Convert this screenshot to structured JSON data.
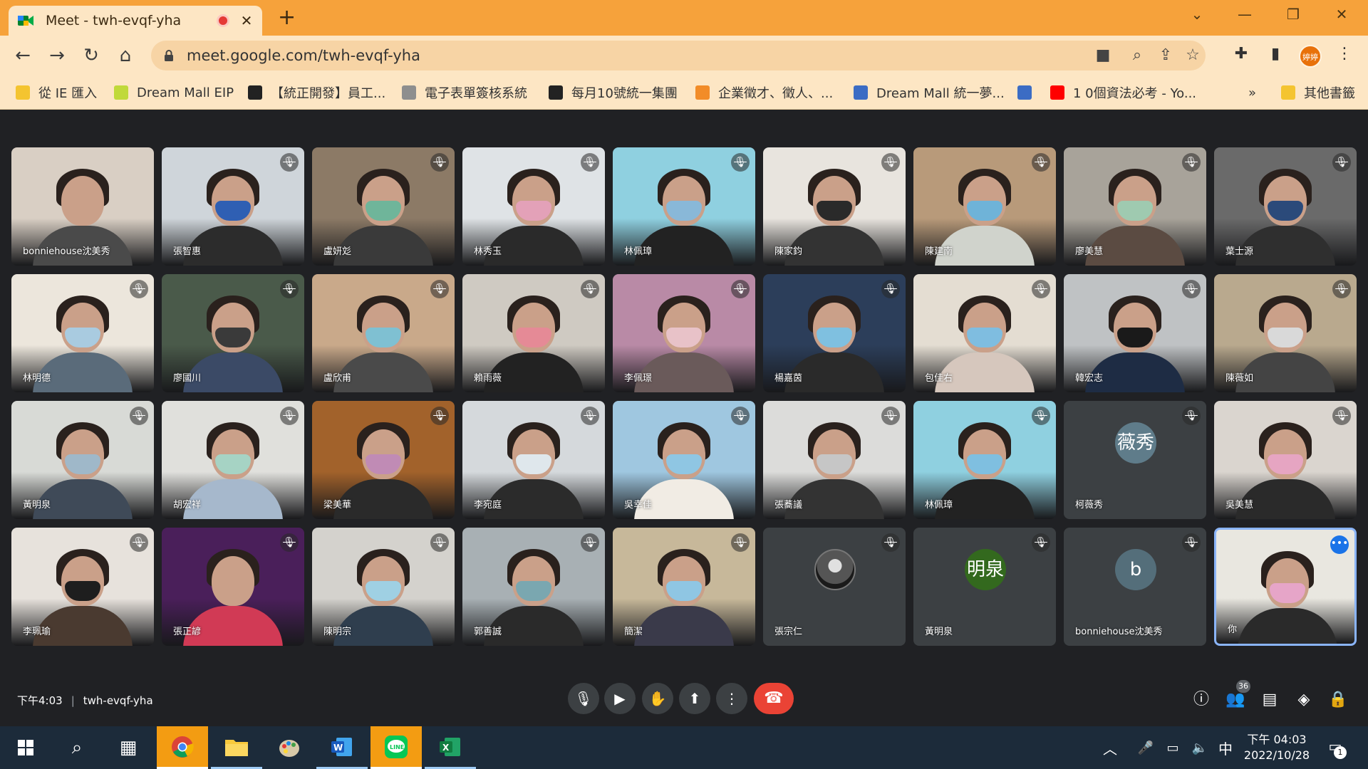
{
  "browser": {
    "tab_title": "Meet - twh-evqf-yha",
    "tab_close": "✕",
    "new_tab": "+",
    "url": "meet.google.com/twh-evqf-yha",
    "profile_label": "婷婷",
    "window_controls": {
      "minimize": "—",
      "restore": "❐",
      "close": "✕",
      "dropdown": "⌄"
    },
    "nav": {
      "back": "←",
      "forward": "→",
      "reload": "↻",
      "home": "⌂"
    }
  },
  "bookmarks": [
    {
      "label": "從 IE 匯入",
      "color": "#f4c430"
    },
    {
      "label": "Dream Mall EIP",
      "color": "#c0d93a"
    },
    {
      "label": "【統正開發】員工...",
      "color": "#222222"
    },
    {
      "label": "電子表單簽核系統",
      "color": "#8e8e8e"
    },
    {
      "label": "每月10號統一集團",
      "color": "#222222"
    },
    {
      "label": "企業徵才、徵人、...",
      "color": "#f28c28"
    },
    {
      "label": "Dream Mall 統一夢...",
      "color": "#3b6cc4"
    },
    {
      "label": "",
      "color": "#3b6cc4"
    },
    {
      "label": "1 0個資法必考 - Yo...",
      "color": "#ff0000"
    }
  ],
  "bookmarks_more": "»",
  "bookmarks_other": {
    "label": "其他書籤",
    "color": "#f4c430"
  },
  "participants": [
    {
      "name": "bonniehouse沈美秀",
      "bg": "#d9cfc4",
      "shirt": "#4a4a4a",
      "mask": "",
      "muted": false
    },
    {
      "name": "張智惠",
      "bg": "#cfd5da",
      "shirt": "#2c2c2c",
      "mask": "#2f5fb3",
      "muted": true
    },
    {
      "name": "盧妍彣",
      "bg": "#8c7a66",
      "shirt": "#3a3a3a",
      "mask": "#6fb59a",
      "muted": true
    },
    {
      "name": "林秀玉",
      "bg": "#dfe3e6",
      "shirt": "#2a2a2a",
      "mask": "#e3a1b8",
      "muted": true
    },
    {
      "name": "林佩璋",
      "bg": "#8fd0e0",
      "shirt": "#222222",
      "mask": "#89b8d8",
      "muted": true
    },
    {
      "name": "陳家鈞",
      "bg": "#e8e4de",
      "shirt": "#333333",
      "mask": "#2a2a2a",
      "muted": true
    },
    {
      "name": "陳建南",
      "bg": "#b89a7a",
      "shirt": "#d0d3cc",
      "mask": "#6fb3d8",
      "muted": true
    },
    {
      "name": "廖美慧",
      "bg": "#a8a39a",
      "shirt": "#5b4b42",
      "mask": "#9fcab0",
      "muted": true
    },
    {
      "name": "葉士源",
      "bg": "#6a6a6a",
      "shirt": "#2f2f2f",
      "mask": "#2b4a7a",
      "muted": true
    },
    {
      "name": "林明德",
      "bg": "#ece6dc",
      "shirt": "#5a6b7a",
      "mask": "#a9cbe0",
      "muted": true
    },
    {
      "name": "廖國川",
      "bg": "#4a5a4a",
      "shirt": "#3b4a66",
      "mask": "#3a3a3a",
      "muted": true
    },
    {
      "name": "盧欣甫",
      "bg": "#c9a98a",
      "shirt": "#4a4a4a",
      "mask": "#7fc0d2",
      "muted": true
    },
    {
      "name": "賴雨薇",
      "bg": "#cfcac2",
      "shirt": "#222222",
      "mask": "#e58a96",
      "muted": true
    },
    {
      "name": "李佩璟",
      "bg": "#b98aa6",
      "shirt": "#6a5a5a",
      "mask": "#e8c2c8",
      "muted": true
    },
    {
      "name": "楊嘉茵",
      "bg": "#2c3e5a",
      "shirt": "#2a2a2a",
      "mask": "#7fc0e0",
      "muted": true
    },
    {
      "name": "包佳右",
      "bg": "#e4ddd2",
      "shirt": "#d6c7bd",
      "mask": "#7fbde0",
      "muted": true
    },
    {
      "name": "韓宏志",
      "bg": "#bfc2c4",
      "shirt": "#1e2c44",
      "mask": "#1a1a1a",
      "muted": true
    },
    {
      "name": "陳薇如",
      "bg": "#b9a98e",
      "shirt": "#444444",
      "mask": "#d9d9d9",
      "muted": true
    },
    {
      "name": "黃明泉",
      "bg": "#d8dad6",
      "shirt": "#3f4a58",
      "mask": "#9fb8c9",
      "muted": true
    },
    {
      "name": "胡宏祥",
      "bg": "#e0e0dc",
      "shirt": "#a6b8cc",
      "mask": "#a6d3c4",
      "muted": true
    },
    {
      "name": "梁美華",
      "bg": "#a2622b",
      "shirt": "#2a2a2a",
      "mask": "#c08bb5",
      "muted": true
    },
    {
      "name": "李宛庭",
      "bg": "#d5d9dc",
      "shirt": "#2b2b2b",
      "mask": "#dfe7ec",
      "muted": true
    },
    {
      "name": "吳幸佳",
      "bg": "#9fc7e0",
      "shirt": "#f1ece4",
      "mask": "#8fc6e3",
      "muted": true
    },
    {
      "name": "張蕎議",
      "bg": "#dcdcda",
      "shirt": "#333333",
      "mask": "#c6c6c6",
      "muted": true
    },
    {
      "name": "林佩璋",
      "bg": "#8fd0e0",
      "shirt": "#222222",
      "mask": "#7fbfe0",
      "muted": true
    },
    {
      "name": "柯薇秀",
      "plain": true,
      "avatar": "薇秀",
      "avatar_color": "#5f7c8a",
      "muted": true
    },
    {
      "name": "吳美慧",
      "bg": "#dad5cf",
      "shirt": "#2a2a2a",
      "mask": "#e6a5c2",
      "muted": true
    },
    {
      "name": "李珮瑜",
      "bg": "#e7e2dc",
      "shirt": "#4a3a30",
      "mask": "#1e1e1e",
      "muted": true
    },
    {
      "name": "張正諺",
      "bg": "#4a1f5a",
      "shirt": "#d13a55",
      "mask": "",
      "muted": true
    },
    {
      "name": "陳明宗",
      "bg": "#d4d2cd",
      "shirt": "#2f3e4e",
      "mask": "#9fd0e3",
      "muted": true
    },
    {
      "name": "郭善誠",
      "bg": "#a8b0b4",
      "shirt": "#2a2a2a",
      "mask": "#7aa7b0",
      "muted": true
    },
    {
      "name": "簡潔",
      "bg": "#c7b89a",
      "shirt": "#3a3a4a",
      "mask": "#8fc6e3",
      "muted": true
    },
    {
      "name": "張宗仁",
      "plain": true,
      "avatar": "",
      "avatar_color": "#1a1a1a",
      "muted": true,
      "photo_avatar": true
    },
    {
      "name": "黃明泉",
      "plain": true,
      "avatar": "明泉",
      "avatar_color": "#33691e",
      "muted": true
    },
    {
      "name": "bonniehouse沈美秀",
      "plain": true,
      "avatar": "b",
      "avatar_color": "#546e7a",
      "muted": true
    },
    {
      "name": "你",
      "bg": "#e9e7e0",
      "shirt": "#2a2a2a",
      "mask": "#e6a5c8",
      "muted": false,
      "self": true
    }
  ],
  "meeting": {
    "time": "下午4:03",
    "code": "twh-evqf-yha",
    "people_count": "36"
  },
  "taskbar": {
    "clock_time": "下午 04:03",
    "clock_date": "2022/10/28",
    "ime": "中",
    "notifications": "1"
  }
}
